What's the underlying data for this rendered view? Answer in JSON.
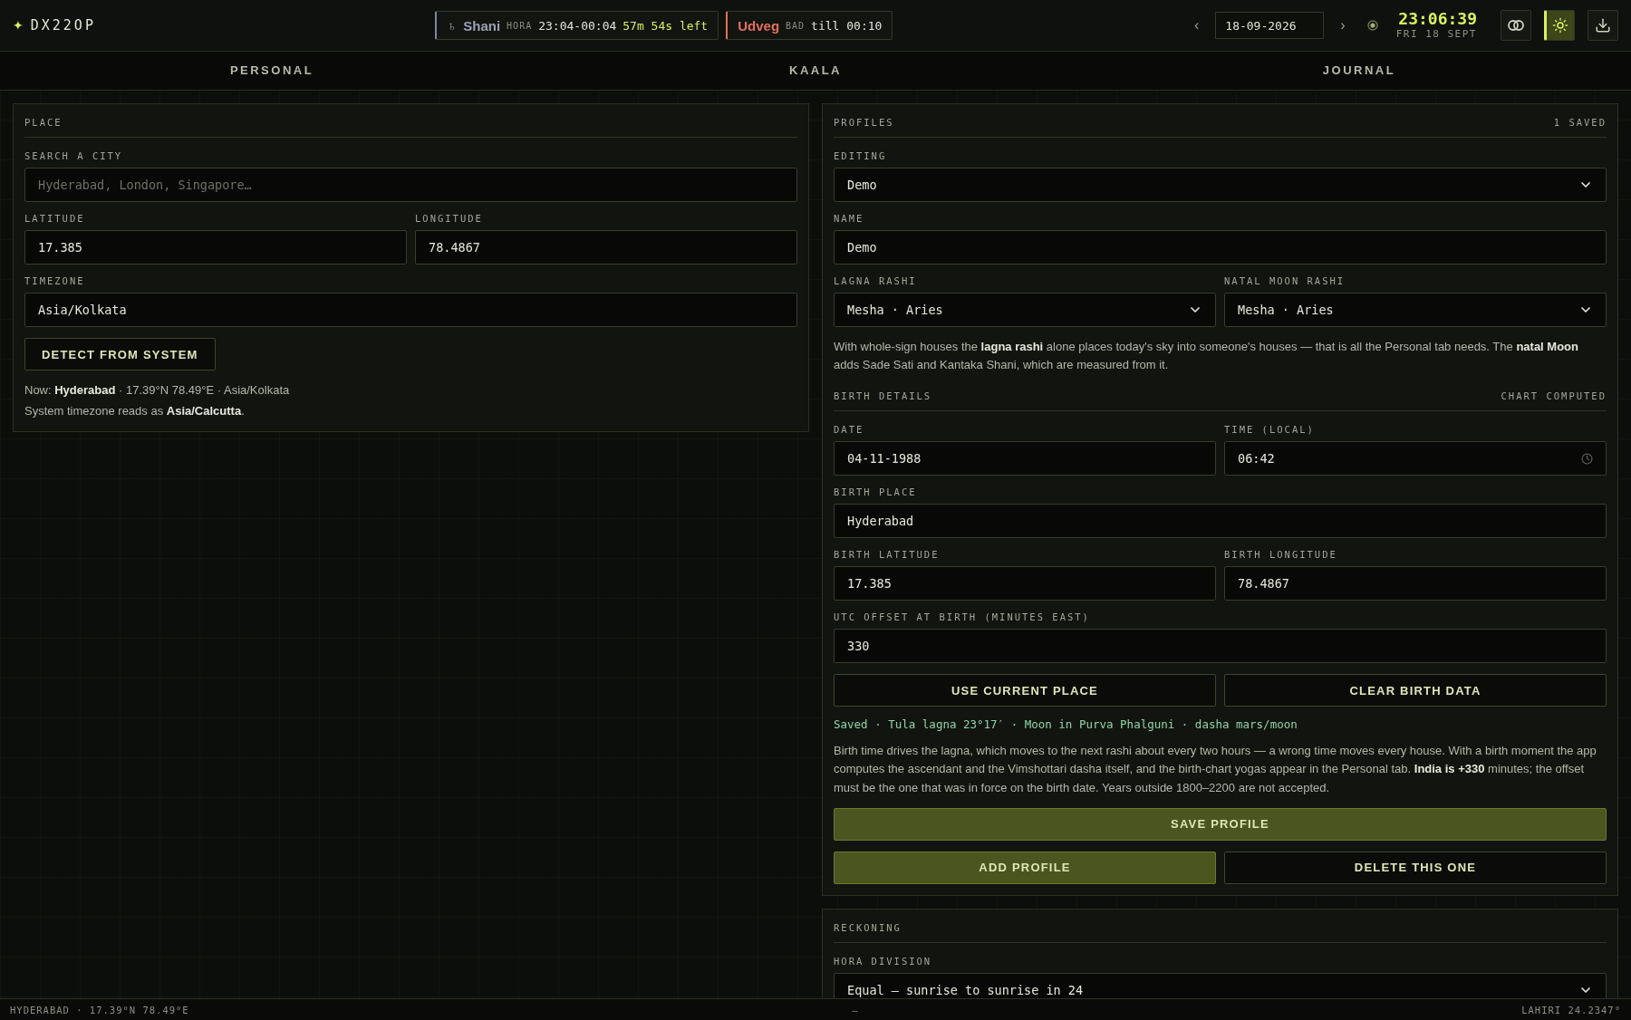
{
  "brand": {
    "mark": "✦",
    "name": "DX22OP"
  },
  "hora": {
    "glyph": "♄",
    "planet": "Shani",
    "tag": "HORA",
    "range": "23:04-00:04",
    "left": "57m 54s left"
  },
  "choghadiya": {
    "name": "Udveg",
    "tag": "BAD",
    "until": "till 00:10"
  },
  "date_nav": {
    "prev": "‹",
    "date": "18-09-2026",
    "next": "›"
  },
  "clock": {
    "time": "23:06:39",
    "date": "FRI 18 SEPT"
  },
  "toolbar": [
    {
      "kind": "rings",
      "selected": false
    },
    {
      "kind": "sun",
      "selected": true
    },
    {
      "kind": "download",
      "selected": false
    }
  ],
  "tabs": [
    {
      "label": "PERSONAL",
      "selected": false
    },
    {
      "label": "KAALA",
      "selected": false
    },
    {
      "label": "JOURNAL",
      "selected": false
    }
  ],
  "left_panels": [
    {
      "title": "PLACE",
      "blocks": [
        {
          "kind": "row",
          "fields": [
            {
              "kind": "search",
              "label": "SEARCH A CITY",
              "placeholder": "Hyderabad, London, Singapore…"
            }
          ]
        },
        {
          "kind": "row",
          "fields": [
            {
              "kind": "text",
              "label": "LATITUDE",
              "value": "17.385"
            },
            {
              "kind": "text",
              "label": "LONGITUDE",
              "value": "78.4867"
            }
          ]
        },
        {
          "kind": "row",
          "fields": [
            {
              "kind": "text",
              "label": "TIMEZONE",
              "value": "Asia/Kolkata"
            }
          ]
        },
        {
          "kind": "buttons",
          "buttons": [
            {
              "label": "DETECT FROM SYSTEM",
              "primary": false,
              "compact": true
            }
          ]
        },
        {
          "kind": "lines",
          "lines": [
            "Now: **Hyderabad** · 17.39°N 78.49°E · Asia/Kolkata",
            "System timezone reads as **Asia/Calcutta**."
          ]
        }
      ]
    }
  ],
  "right_panels": [
    {
      "title": "PROFILES",
      "meta": "1 SAVED",
      "blocks": [
        {
          "kind": "row",
          "fields": [
            {
              "kind": "select",
              "label": "EDITING",
              "value": "Demo"
            }
          ]
        },
        {
          "kind": "row",
          "fields": [
            {
              "kind": "text",
              "label": "NAME",
              "value": "Demo"
            }
          ]
        },
        {
          "kind": "row",
          "fields": [
            {
              "kind": "select",
              "label": "LAGNA RASHI",
              "value": "Mesha · Aries"
            },
            {
              "kind": "select",
              "label": "NATAL MOON RASHI",
              "value": "Mesha · Aries"
            }
          ]
        },
        {
          "kind": "note",
          "text": "With whole-sign houses the **lagna rashi** alone places today's sky into someone's houses — that is all the Personal tab needs. The **natal Moon** adds Sade Sati and Kantaka Shani, which are measured from it."
        },
        {
          "kind": "heading",
          "title": "BIRTH DETAILS",
          "meta": "CHART COMPUTED"
        },
        {
          "kind": "row",
          "fields": [
            {
              "kind": "text",
              "label": "DATE",
              "value": "04-11-1988"
            },
            {
              "kind": "time",
              "label": "TIME (LOCAL)",
              "value": "06:42"
            }
          ]
        },
        {
          "kind": "row",
          "fields": [
            {
              "kind": "text",
              "label": "BIRTH PLACE",
              "value": "Hyderabad"
            }
          ]
        },
        {
          "kind": "row",
          "fields": [
            {
              "kind": "text",
              "label": "BIRTH LATITUDE",
              "value": "17.385"
            },
            {
              "kind": "text",
              "label": "BIRTH LONGITUDE",
              "value": "78.4867"
            }
          ]
        },
        {
          "kind": "row",
          "fields": [
            {
              "kind": "text",
              "label": "UTC OFFSET AT BIRTH (MINUTES EAST)",
              "value": "330"
            }
          ]
        },
        {
          "kind": "buttons",
          "buttons": [
            {
              "label": "USE CURRENT PLACE",
              "primary": false,
              "compact": false
            },
            {
              "label": "CLEAR BIRTH DATA",
              "primary": false,
              "compact": false
            }
          ]
        },
        {
          "kind": "status",
          "text": "Saved · Tula lagna 23°17′ · Moon in Purva Phalguni · dasha mars/moon"
        },
        {
          "kind": "note",
          "text": "Birth time drives the lagna, which moves to the next rashi about every two hours — a wrong time moves every house. With a birth moment the app computes the ascendant and the Vimshottari dasha itself, and the birth-chart yogas appear in the Personal tab. **India is +330** minutes; the offset must be the one that was in force on the birth date. Years outside 1800–2200 are not accepted."
        },
        {
          "kind": "buttons",
          "buttons": [
            {
              "label": "SAVE PROFILE",
              "primary": true,
              "compact": false
            }
          ]
        },
        {
          "kind": "buttons",
          "buttons": [
            {
              "label": "ADD PROFILE",
              "primary": true,
              "compact": false
            },
            {
              "label": "DELETE THIS ONE",
              "primary": false,
              "compact": false
            }
          ]
        }
      ]
    },
    {
      "title": "RECKONING",
      "blocks": [
        {
          "kind": "row",
          "fields": [
            {
              "kind": "select",
              "label": "HORA DIVISION",
              "value": "Equal — sunrise to sunrise in 24"
            }
          ]
        }
      ]
    }
  ],
  "status_bar": {
    "place": "HYDERABAD · 17.39°N 78.49°E",
    "middle": "—",
    "ayanamsa": "LAHIRI 24.2347°"
  }
}
